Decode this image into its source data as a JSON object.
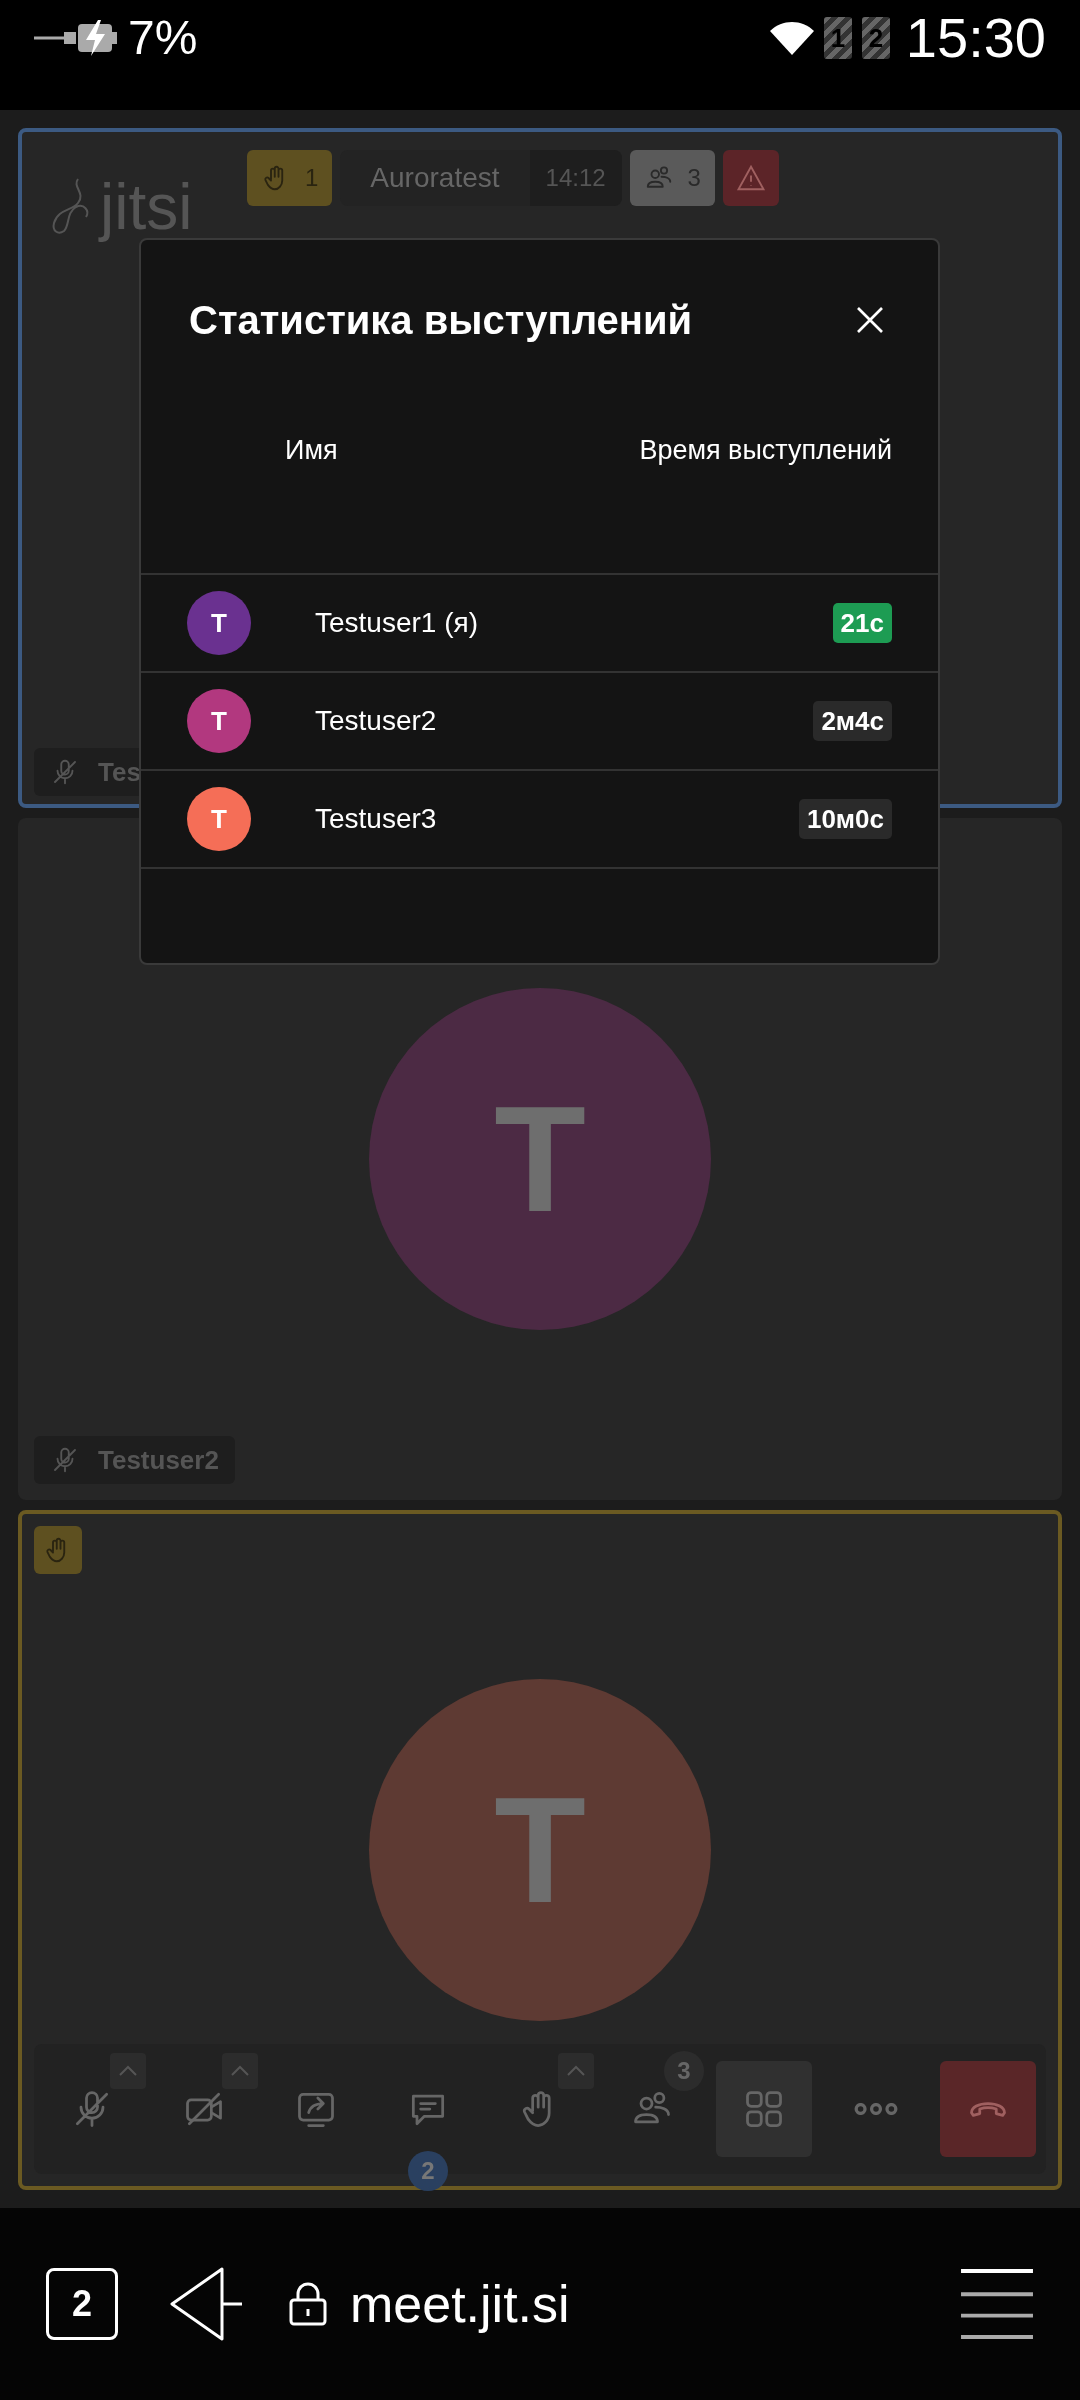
{
  "status_bar": {
    "battery": "7%",
    "sims": [
      "1",
      "2"
    ],
    "time": "15:30"
  },
  "conference": {
    "logo": "jitsi",
    "raised_hands": "1",
    "title": "Auroratest",
    "timer": "14:12",
    "participants": "3"
  },
  "tiles": [
    {
      "name": "Tes",
      "speaking": true,
      "muted": true,
      "hand_raised": false
    },
    {
      "name": "Testuser2",
      "speaking": false,
      "muted": true,
      "hand_raised": false,
      "avatar": "T",
      "color": "#4c2a44"
    },
    {
      "speaking": false,
      "hand_raised": true,
      "avatar": "T",
      "color": "#5e3a33"
    }
  ],
  "dialog": {
    "title": "Статистика выступлений",
    "columns": [
      "Имя",
      "Время выступлений"
    ],
    "rows": [
      {
        "avatar": "T",
        "color": "#6a3190",
        "name": "Testuser1 (я)",
        "time": "21с",
        "selected": true
      },
      {
        "avatar": "T",
        "color": "#b2387f",
        "name": "Testuser2",
        "time": "2м4с",
        "selected": false
      },
      {
        "avatar": "T",
        "color": "#f56e57",
        "name": "Testuser3",
        "time": "10м0с",
        "selected": false
      }
    ]
  },
  "toolbar": [
    {
      "kind": "mic",
      "caret": true
    },
    {
      "kind": "camera",
      "caret": true
    },
    {
      "kind": "share",
      "caret": false
    },
    {
      "kind": "chat",
      "caret": false,
      "badge": "2"
    },
    {
      "kind": "hand",
      "caret": true
    },
    {
      "kind": "participants",
      "caret": false,
      "badge": "3"
    },
    {
      "kind": "tiles",
      "caret": false,
      "selected": true
    },
    {
      "kind": "more",
      "caret": false
    },
    {
      "kind": "hangup",
      "caret": false
    }
  ],
  "browser": {
    "tabs": "2",
    "url": "meet.jit.si"
  }
}
